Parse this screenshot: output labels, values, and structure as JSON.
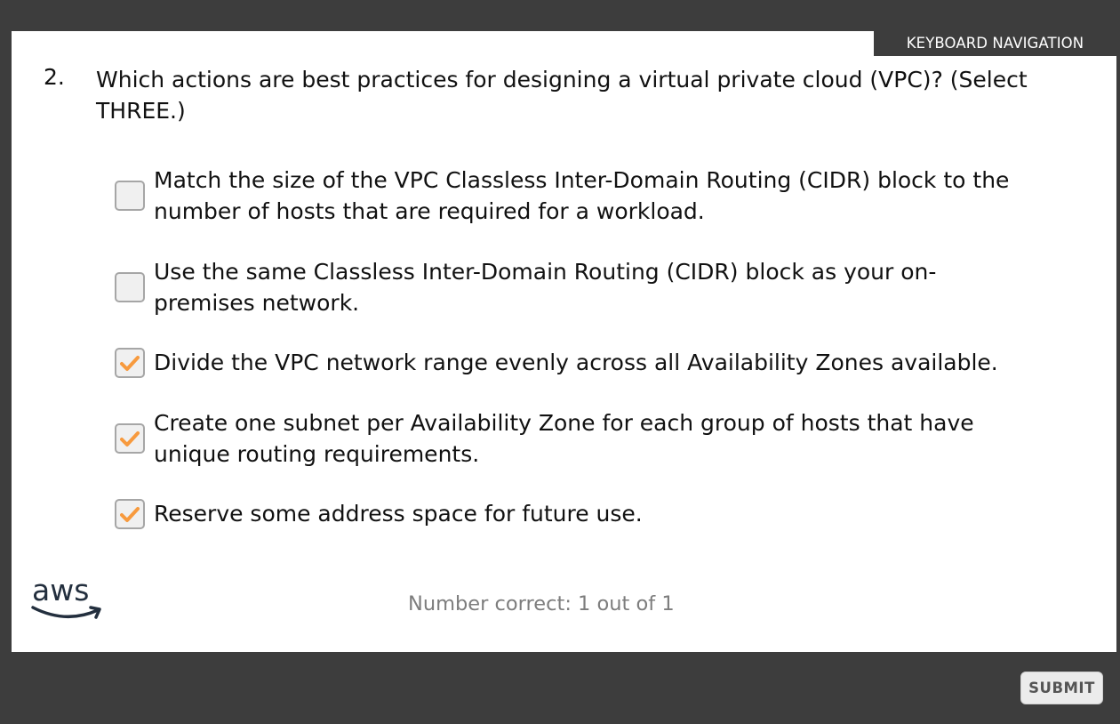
{
  "header": {
    "keyboard_navigation_label": "KEYBOARD NAVIGATION"
  },
  "question": {
    "number": "2.",
    "text": "Which actions are best practices for designing a virtual private cloud (VPC)? (Select THREE.)"
  },
  "options": [
    {
      "label": "Match the size of the VPC Classless Inter-Domain Routing (CIDR) block to the number of hosts that are required for a workload.",
      "checked": false
    },
    {
      "label": "Use the same Classless Inter-Domain Routing (CIDR) block as your on-premises network.",
      "checked": false
    },
    {
      "label": "Divide the VPC network range evenly across all Availability Zones available.",
      "checked": true
    },
    {
      "label": "Create one subnet per Availability Zone for each group of hosts that have unique routing requirements.",
      "checked": true
    },
    {
      "label": "Reserve some address space for future use.",
      "checked": true
    }
  ],
  "footer": {
    "logo_text": "aws",
    "score_text": "Number correct: 1 out of 1",
    "submit_label": "SUBMIT"
  },
  "colors": {
    "frame": "#3d3d3d",
    "checkmark": "#f79a3e",
    "logo_smile": "#232f3e"
  }
}
